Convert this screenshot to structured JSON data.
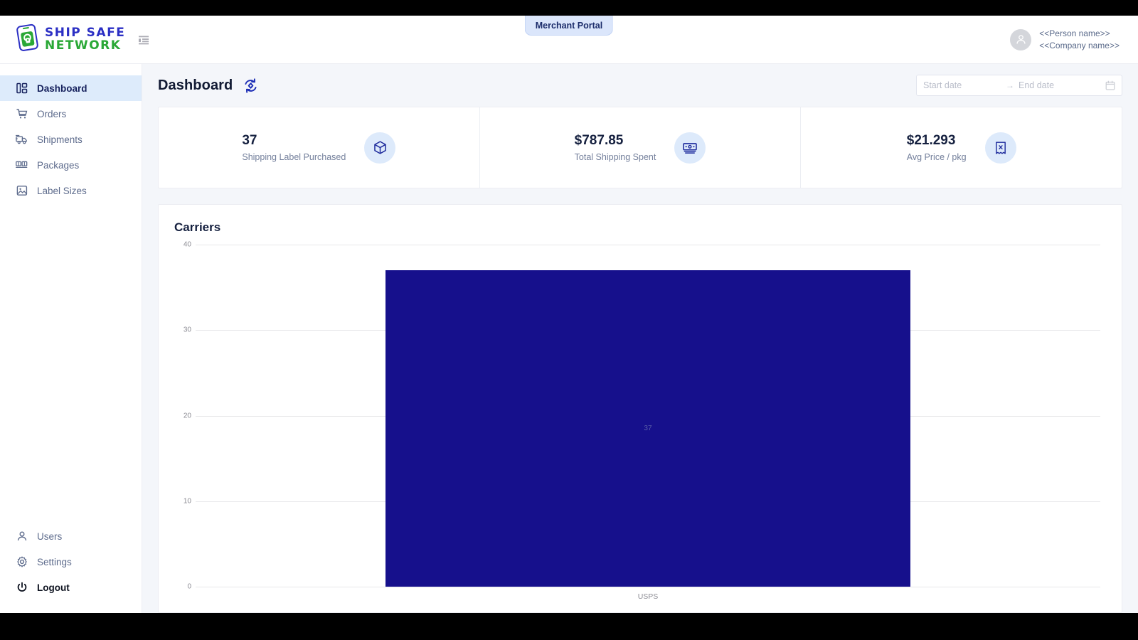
{
  "topbar": {
    "logo_line1": "SHIP SAFE",
    "logo_line2": "NETWORK",
    "menu_icon": "menu-indent-icon",
    "portal_badge": "Merchant Portal",
    "person_name": "<<Person name>>",
    "company_name": "<<Company name>>",
    "avatar_icon": "user-avatar-icon"
  },
  "sidebar": {
    "items": [
      {
        "label": "Dashboard",
        "icon": "dashboard-icon",
        "active": true
      },
      {
        "label": "Orders",
        "icon": "cart-icon",
        "active": false
      },
      {
        "label": "Shipments",
        "icon": "truck-icon",
        "active": false
      },
      {
        "label": "Packages",
        "icon": "boxes-icon",
        "active": false
      },
      {
        "label": "Label Sizes",
        "icon": "label-icon",
        "active": false
      }
    ],
    "bottom_items": [
      {
        "label": "Users",
        "icon": "user-icon",
        "strong": false
      },
      {
        "label": "Settings",
        "icon": "gear-icon",
        "strong": false
      },
      {
        "label": "Logout",
        "icon": "power-icon",
        "strong": true
      }
    ]
  },
  "page": {
    "title": "Dashboard",
    "refresh_icon": "refresh-sync-icon",
    "date_start_placeholder": "Start date",
    "date_end_placeholder": "End date",
    "date_start_value": "",
    "date_end_value": "",
    "date_arrow": "→",
    "calendar_icon": "calendar-icon"
  },
  "stats": [
    {
      "value": "37",
      "label": "Shipping Label Purchased",
      "icon": "package-box-icon"
    },
    {
      "value": "$787.85",
      "label": "Total Shipping Spent",
      "icon": "banknote-icon"
    },
    {
      "value": "$21.293",
      "label": "Avg Price / pkg",
      "icon": "receipt-icon"
    }
  ],
  "chart_data": {
    "type": "bar",
    "title": "Carriers",
    "categories": [
      "USPS"
    ],
    "values": [
      37
    ],
    "data_labels": [
      "37"
    ],
    "xlabel": "",
    "ylabel": "",
    "ylim": [
      0,
      40
    ],
    "yticks": [
      40,
      30,
      20,
      10,
      0
    ],
    "grid": true,
    "legend": false,
    "bar_color": "#16108c",
    "data_label_color": "#5b5fa8"
  },
  "colors": {
    "accent": "#2b2fc4",
    "brand_green": "#2aa836",
    "bar": "#16108c",
    "sidebar_active_bg": "#ddebfb",
    "badge_bg": "#dbe6fb",
    "stat_icon_bg": "#ddeafb"
  }
}
